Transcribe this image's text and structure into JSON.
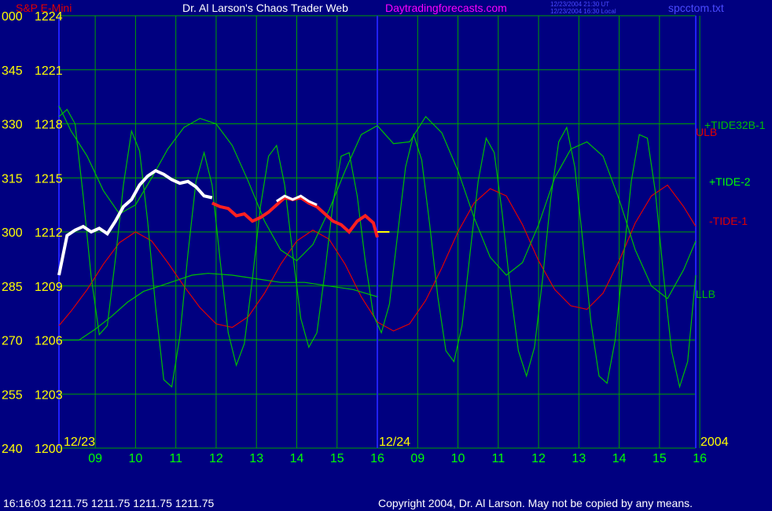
{
  "header": {
    "symbol": "S&P E-Mini",
    "title": "Dr. Al Larson's Chaos Trader Web",
    "site": "Daytradingforecasts.com",
    "time_ut": "12/23/2004 21:30 UT",
    "time_local": "12/23/2004 16:30 Local",
    "file": "spcctom.txt"
  },
  "footer": {
    "quote": "16:16:03  1211.75  1211.75  1211.75  1211.75",
    "copyright": "Copyright 2004, Dr. Al Larson. May not be copied by any means."
  },
  "colors": {
    "background": "#000080",
    "grid": "#00A000",
    "tide": "#00C000",
    "red_line": "#E00000",
    "yellow": "#FFFF00",
    "green_text": "#00FF00",
    "magenta": "#FF00FF"
  },
  "chart_data": {
    "type": "line",
    "y_axis": {
      "left_ticks": [
        "000",
        "345",
        "330",
        "315",
        "300",
        "285",
        "270",
        "255",
        "240"
      ],
      "right_ticks": [
        "1224",
        "1221",
        "1218",
        "1215",
        "1212",
        "1209",
        "1206",
        "1203",
        "1200"
      ],
      "ylim": [
        1200,
        1224
      ]
    },
    "x_axis": {
      "ticks": [
        "09",
        "10",
        "11",
        "12",
        "13",
        "14",
        "15",
        "16",
        "09",
        "10",
        "11",
        "12",
        "13",
        "14",
        "15",
        "16"
      ],
      "date_labels": [
        "12/23",
        "12/24"
      ],
      "year_label": "2004",
      "xlim": [
        8.1,
        23.9
      ]
    },
    "series_labels": [
      "+TIDE32B-1",
      "ULB",
      "+TIDE-2",
      "-TIDE-1",
      "LLB"
    ],
    "series": [
      {
        "name": "ULB",
        "color": "#E00000",
        "points": [
          [
            8.1,
            1206.8
          ],
          [
            8.4,
            1207.6
          ],
          [
            8.8,
            1208.8
          ],
          [
            9.2,
            1210.2
          ],
          [
            9.6,
            1211.4
          ],
          [
            10.0,
            1212.0
          ],
          [
            10.4,
            1211.5
          ],
          [
            10.8,
            1210.3
          ],
          [
            11.2,
            1209.0
          ],
          [
            11.6,
            1207.8
          ],
          [
            12.0,
            1206.9
          ],
          [
            12.4,
            1206.7
          ],
          [
            12.8,
            1207.3
          ],
          [
            13.2,
            1208.6
          ],
          [
            13.6,
            1210.2
          ],
          [
            14.0,
            1211.5
          ],
          [
            14.4,
            1212.1
          ],
          [
            14.8,
            1211.6
          ],
          [
            15.2,
            1210.2
          ],
          [
            15.6,
            1208.4
          ],
          [
            16.0,
            1207.0
          ],
          [
            16.4,
            1206.5
          ],
          [
            16.8,
            1206.9
          ],
          [
            17.2,
            1208.2
          ],
          [
            17.6,
            1210.0
          ],
          [
            18.0,
            1212.0
          ],
          [
            18.4,
            1213.6
          ],
          [
            18.8,
            1214.4
          ],
          [
            19.2,
            1214.0
          ],
          [
            19.6,
            1212.4
          ],
          [
            20.0,
            1210.4
          ],
          [
            20.4,
            1208.8
          ],
          [
            20.8,
            1207.9
          ],
          [
            21.2,
            1207.7
          ],
          [
            21.6,
            1208.6
          ],
          [
            22.0,
            1210.4
          ],
          [
            22.4,
            1212.5
          ],
          [
            22.8,
            1214.0
          ],
          [
            23.2,
            1214.6
          ],
          [
            23.6,
            1213.4
          ],
          [
            23.9,
            1212.3
          ]
        ]
      },
      {
        "name": "+TIDE32B-1",
        "color": "#00C000",
        "points": [
          [
            8.1,
            1219.0
          ],
          [
            8.4,
            1217.6
          ],
          [
            8.8,
            1216.2
          ],
          [
            9.2,
            1214.3
          ],
          [
            9.6,
            1213.0
          ],
          [
            10.0,
            1213.5
          ],
          [
            10.4,
            1215.0
          ],
          [
            10.8,
            1216.6
          ],
          [
            11.2,
            1217.8
          ],
          [
            11.6,
            1218.3
          ],
          [
            12.0,
            1218.0
          ],
          [
            12.4,
            1216.8
          ],
          [
            12.8,
            1214.8
          ],
          [
            13.2,
            1212.6
          ],
          [
            13.6,
            1211.0
          ],
          [
            14.0,
            1210.4
          ],
          [
            14.4,
            1211.3
          ],
          [
            14.8,
            1213.2
          ],
          [
            15.2,
            1215.4
          ],
          [
            15.6,
            1217.4
          ],
          [
            16.0,
            1217.9
          ],
          [
            16.4,
            1216.9
          ],
          [
            16.8,
            1217.0
          ],
          [
            17.2,
            1218.4
          ],
          [
            17.6,
            1217.5
          ],
          [
            18.0,
            1215.4
          ],
          [
            18.4,
            1212.8
          ],
          [
            18.8,
            1210.6
          ],
          [
            19.2,
            1209.6
          ],
          [
            19.6,
            1210.3
          ],
          [
            20.0,
            1212.4
          ],
          [
            20.4,
            1215.0
          ],
          [
            20.8,
            1216.6
          ],
          [
            21.2,
            1217.0
          ],
          [
            21.6,
            1216.2
          ],
          [
            22.0,
            1213.8
          ],
          [
            22.4,
            1211.0
          ],
          [
            22.8,
            1209.0
          ],
          [
            23.2,
            1208.3
          ],
          [
            23.6,
            1209.9
          ],
          [
            23.9,
            1211.5
          ]
        ]
      },
      {
        "name": "LLB",
        "color": "#00C000",
        "points": [
          [
            8.1,
            1206.0
          ],
          [
            8.6,
            1206.0
          ],
          [
            9.0,
            1206.6
          ],
          [
            9.4,
            1207.3
          ],
          [
            9.8,
            1208.1
          ],
          [
            10.2,
            1208.7
          ],
          [
            10.6,
            1209.0
          ],
          [
            11.0,
            1209.3
          ],
          [
            11.4,
            1209.6
          ],
          [
            11.8,
            1209.7
          ],
          [
            12.4,
            1209.6
          ],
          [
            13.0,
            1209.4
          ],
          [
            13.6,
            1209.2
          ],
          [
            14.2,
            1209.2
          ],
          [
            14.8,
            1209.0
          ],
          [
            15.4,
            1208.8
          ],
          [
            16.0,
            1208.4
          ]
        ]
      },
      {
        "name": "+TIDE-2",
        "color": "#00C000",
        "points": [
          [
            8.1,
            1218.4
          ],
          [
            8.3,
            1218.8
          ],
          [
            8.5,
            1218.0
          ],
          [
            8.7,
            1214.0
          ],
          [
            8.9,
            1209.5
          ],
          [
            9.1,
            1206.3
          ],
          [
            9.3,
            1206.8
          ],
          [
            9.5,
            1210.5
          ],
          [
            9.7,
            1214.6
          ],
          [
            9.9,
            1217.6
          ],
          [
            10.1,
            1216.5
          ],
          [
            10.3,
            1212.6
          ],
          [
            10.5,
            1207.8
          ],
          [
            10.7,
            1203.8
          ],
          [
            10.9,
            1203.4
          ],
          [
            11.1,
            1206.2
          ],
          [
            11.3,
            1210.8
          ],
          [
            11.5,
            1214.8
          ],
          [
            11.7,
            1216.4
          ],
          [
            11.9,
            1214.6
          ],
          [
            12.1,
            1210.4
          ],
          [
            12.3,
            1206.4
          ],
          [
            12.5,
            1204.6
          ],
          [
            12.7,
            1205.8
          ],
          [
            12.9,
            1209.4
          ],
          [
            13.1,
            1213.4
          ],
          [
            13.3,
            1216.2
          ],
          [
            13.5,
            1216.8
          ],
          [
            13.7,
            1214.6
          ],
          [
            13.9,
            1210.8
          ],
          [
            14.1,
            1207.2
          ],
          [
            14.3,
            1205.6
          ],
          [
            14.5,
            1206.4
          ],
          [
            14.7,
            1209.8
          ],
          [
            14.9,
            1213.6
          ],
          [
            15.1,
            1216.2
          ],
          [
            15.3,
            1216.4
          ],
          [
            15.5,
            1214.0
          ],
          [
            15.7,
            1210.4
          ],
          [
            15.9,
            1207.4
          ],
          [
            16.1,
            1206.4
          ],
          [
            16.3,
            1208.0
          ],
          [
            16.5,
            1211.8
          ],
          [
            16.7,
            1215.6
          ],
          [
            16.9,
            1217.4
          ],
          [
            17.1,
            1216.0
          ],
          [
            17.3,
            1212.4
          ],
          [
            17.5,
            1208.4
          ],
          [
            17.7,
            1205.4
          ],
          [
            17.9,
            1204.8
          ],
          [
            18.1,
            1206.8
          ],
          [
            18.3,
            1210.8
          ],
          [
            18.5,
            1214.8
          ],
          [
            18.7,
            1217.2
          ],
          [
            18.9,
            1216.4
          ],
          [
            19.1,
            1213.0
          ],
          [
            19.3,
            1208.8
          ],
          [
            19.5,
            1205.4
          ],
          [
            19.7,
            1204.0
          ],
          [
            19.9,
            1205.6
          ],
          [
            20.1,
            1209.4
          ],
          [
            20.3,
            1213.8
          ],
          [
            20.5,
            1217.0
          ],
          [
            20.7,
            1217.8
          ],
          [
            20.9,
            1215.6
          ],
          [
            21.1,
            1211.4
          ],
          [
            21.3,
            1207.0
          ],
          [
            21.5,
            1204.0
          ],
          [
            21.7,
            1203.6
          ],
          [
            21.9,
            1206.0
          ],
          [
            22.1,
            1210.4
          ],
          [
            22.3,
            1214.8
          ],
          [
            22.5,
            1217.4
          ],
          [
            22.7,
            1217.2
          ],
          [
            22.9,
            1214.2
          ],
          [
            23.1,
            1209.6
          ],
          [
            23.3,
            1205.4
          ],
          [
            23.5,
            1203.4
          ],
          [
            23.7,
            1204.8
          ],
          [
            23.9,
            1209.6
          ]
        ]
      }
    ],
    "price": {
      "white_points": [
        [
          8.1,
          1209.6
        ],
        [
          8.3,
          1211.8
        ],
        [
          8.5,
          1212.1
        ],
        [
          8.7,
          1212.3
        ],
        [
          8.9,
          1212.0
        ],
        [
          9.1,
          1212.2
        ],
        [
          9.3,
          1211.9
        ],
        [
          9.5,
          1212.6
        ],
        [
          9.7,
          1213.4
        ],
        [
          9.9,
          1213.8
        ],
        [
          10.1,
          1214.6
        ],
        [
          10.3,
          1215.1
        ],
        [
          10.5,
          1215.4
        ],
        [
          10.7,
          1215.2
        ],
        [
          10.9,
          1214.9
        ],
        [
          11.1,
          1214.7
        ],
        [
          11.3,
          1214.8
        ],
        [
          11.5,
          1214.5
        ],
        [
          11.7,
          1214.0
        ],
        [
          11.9,
          1213.9
        ]
      ],
      "red_points": [
        [
          11.9,
          1213.6
        ],
        [
          12.1,
          1213.4
        ],
        [
          12.3,
          1213.3
        ],
        [
          12.5,
          1212.9
        ],
        [
          12.7,
          1213.0
        ],
        [
          12.9,
          1212.6
        ],
        [
          13.1,
          1212.8
        ],
        [
          13.3,
          1213.1
        ],
        [
          13.5,
          1213.5
        ],
        [
          13.7,
          1213.9
        ],
        [
          13.9,
          1213.8
        ],
        [
          14.1,
          1213.9
        ],
        [
          14.3,
          1213.6
        ],
        [
          14.5,
          1213.4
        ],
        [
          14.7,
          1213.0
        ],
        [
          14.9,
          1212.6
        ],
        [
          15.1,
          1212.4
        ],
        [
          15.3,
          1212.0
        ],
        [
          15.5,
          1212.6
        ],
        [
          15.7,
          1212.9
        ],
        [
          15.9,
          1212.5
        ],
        [
          16.0,
          1211.7
        ]
      ],
      "white_overlay": [
        [
          13.5,
          1213.7
        ],
        [
          13.7,
          1214.0
        ],
        [
          13.9,
          1213.8
        ],
        [
          14.1,
          1214.0
        ],
        [
          14.3,
          1213.7
        ],
        [
          14.5,
          1213.5
        ]
      ],
      "yellow_segment": [
        [
          16.0,
          1212.0
        ],
        [
          16.3,
          1212.0
        ]
      ]
    }
  }
}
